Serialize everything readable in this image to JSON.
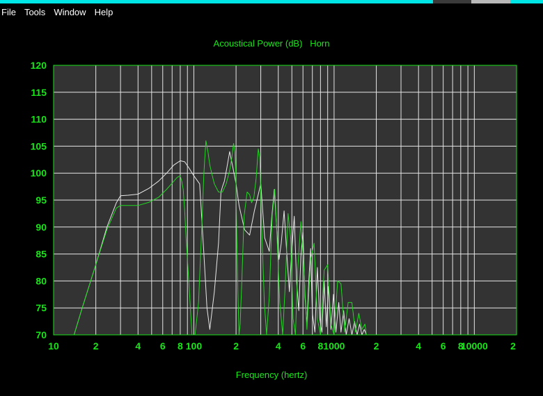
{
  "menu": [
    "File",
    "Tools",
    "Window",
    "Help"
  ],
  "colors": {
    "plot_bg": "#333333",
    "grid": "#e6e6e6",
    "frame": "#19e619",
    "text": "#19e619",
    "series_green": "#22d922",
    "series_white": "#e8e8e8"
  },
  "chart_data": {
    "type": "line",
    "title": "Acoustical Power (dB)   Horn",
    "xlabel": "Frequency (hertz)",
    "ylabel": "",
    "xscale": "log",
    "xlim": [
      10,
      20000
    ],
    "ylim": [
      70,
      120
    ],
    "grid": true,
    "xtick_labels": [
      "10",
      "2",
      "4",
      "6",
      "8",
      "100",
      "2",
      "4",
      "6",
      "8",
      "1000",
      "2",
      "4",
      "6",
      "8",
      "10000",
      "2"
    ],
    "ytick_labels": [
      "120",
      "115",
      "110",
      "105",
      "100",
      "95",
      "90",
      "85",
      "80",
      "75",
      "70"
    ],
    "series": [
      {
        "color": "#e8e8e8",
        "x": [
          14,
          16,
          20,
          24,
          28,
          30,
          34,
          40,
          48,
          56,
          64,
          72,
          80,
          86,
          92,
          100,
          110,
          118,
          124,
          130,
          140,
          150,
          156,
          160,
          165,
          172,
          180,
          190,
          200,
          210,
          230,
          250,
          270,
          300,
          320,
          345,
          360,
          375,
          390,
          405,
          420,
          440,
          460,
          480,
          500,
          520,
          540,
          560,
          580,
          600,
          620,
          640,
          660,
          680,
          700,
          730,
          760,
          790,
          820,
          850,
          880,
          910,
          950,
          990,
          1030,
          1080,
          1120,
          1170,
          1220,
          1280,
          1340,
          1400,
          1460,
          1520,
          1580,
          1640,
          1700
        ],
        "y": [
          70,
          75,
          83,
          90,
          94.5,
          95.8,
          95.9,
          96.1,
          97.2,
          98.5,
          100.0,
          101.5,
          102.3,
          102.1,
          101.0,
          99.5,
          98.0,
          85.0,
          75.0,
          71.0,
          78.0,
          87.0,
          96.5,
          97.5,
          98.5,
          101.0,
          104.0,
          101.0,
          98.0,
          94.0,
          89.5,
          88.5,
          93.0,
          98.0,
          88.0,
          85.5,
          92.0,
          97.0,
          89.5,
          84.0,
          87.0,
          93.0,
          85.0,
          78.0,
          86.0,
          92.0,
          80.0,
          74.5,
          84.5,
          89.0,
          77.0,
          72.0,
          80.0,
          86.0,
          74.0,
          70.5,
          82.5,
          73.0,
          70.5,
          80.0,
          71.5,
          79.0,
          71.0,
          77.5,
          70.5,
          76.0,
          70.5,
          74.5,
          70.0,
          73.0,
          70.0,
          72.5,
          70.0,
          72.0,
          70.0,
          71.0,
          70.0
        ]
      },
      {
        "color": "#22d922",
        "x": [
          14,
          16,
          20,
          24,
          28,
          30,
          34,
          40,
          48,
          56,
          64,
          72,
          76,
          80,
          82,
          84,
          86,
          88,
          92,
          97,
          102,
          108,
          114,
          118,
          122,
          126,
          130,
          134,
          140,
          150,
          160,
          170,
          180,
          187,
          192,
          196,
          199,
          202,
          206,
          210,
          214,
          220,
          228,
          240,
          250,
          258,
          268,
          278,
          288,
          295,
          305,
          318,
          330,
          345,
          362,
          378,
          392,
          410,
          430,
          450,
          470,
          490,
          510,
          530,
          550,
          580,
          610,
          640,
          680,
          720,
          760,
          800,
          850,
          900,
          950,
          1000,
          1060,
          1120,
          1190,
          1260,
          1340,
          1420,
          1500,
          1580,
          1660,
          1700
        ],
        "y": [
          70,
          75,
          83,
          89.5,
          93.5,
          94.0,
          94.0,
          94.0,
          94.6,
          95.5,
          97.0,
          98.5,
          99.2,
          99.5,
          98.5,
          97.0,
          93.0,
          88.0,
          80.0,
          70.0,
          70.0,
          76.0,
          90.0,
          100.0,
          106.0,
          104.0,
          101.5,
          100.0,
          98.0,
          96.5,
          96.5,
          98.0,
          100.5,
          103.0,
          105.5,
          104.0,
          100.0,
          90.0,
          78.0,
          70.0,
          72.0,
          80.0,
          92.0,
          96.5,
          96.0,
          94.5,
          95.5,
          99.0,
          104.5,
          103.0,
          90.0,
          76.0,
          70.0,
          77.0,
          92.0,
          97.0,
          88.0,
          76.0,
          70.0,
          80.0,
          92.5,
          88.0,
          73.0,
          70.0,
          82.0,
          91.0,
          82.0,
          71.0,
          84.0,
          87.0,
          73.0,
          70.0,
          82.0,
          83.0,
          72.0,
          70.0,
          80.0,
          79.5,
          70.5,
          76.0,
          76.0,
          70.5,
          74.0,
          71.0,
          72.0,
          70.0
        ]
      }
    ]
  }
}
